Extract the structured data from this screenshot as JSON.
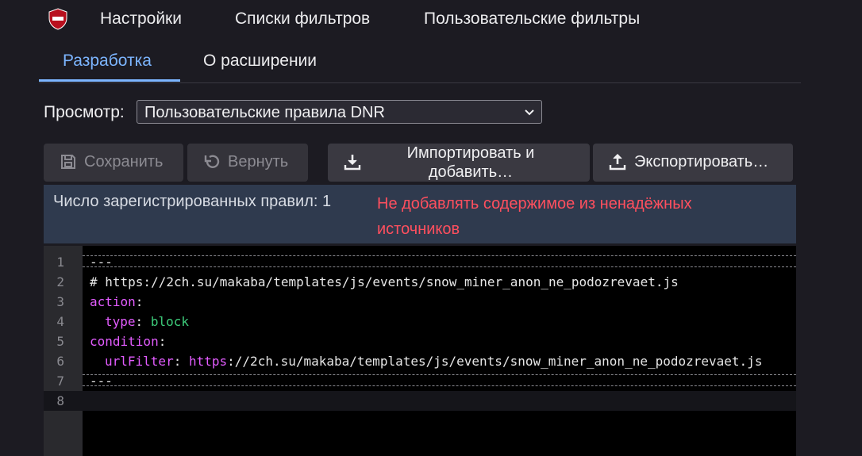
{
  "topnav": {
    "tabs": [
      "Настройки",
      "Списки фильтров",
      "Пользовательские фильтры"
    ]
  },
  "subtabs": [
    "Разработка",
    "О расширении"
  ],
  "view": {
    "label": "Просмотр:",
    "selected": "Пользовательские правила DNR"
  },
  "toolbar": {
    "save": "Сохранить",
    "revert": "Вернуть",
    "import_line1": "Импортировать и",
    "import_line2": "добавить…",
    "export": "Экспортировать…"
  },
  "info": {
    "count": "Число зарегистрированных правил: 1",
    "warning": "Не добавлять содержимое из ненадёжных источников"
  },
  "editor": {
    "line_numbers": [
      "1",
      "2",
      "3",
      "4",
      "5",
      "6",
      "7",
      "8"
    ],
    "sep": "---",
    "comment": "# https://2ch.su/makaba/templates/js/events/snow_miner_anon_ne_podozrevaet.js",
    "action_key": "action",
    "type_key": "type",
    "type_value": "block",
    "condition_key": "condition",
    "urlfilter_key": "urlFilter",
    "urlfilter_scheme": "https",
    "urlfilter_rest": "://2ch.su/makaba/templates/js/events/snow_miner_anon_ne_podozrevaet.js",
    "colon": ":"
  },
  "colors": {
    "accent": "#7cb5ff",
    "warning": "#ff4f5e",
    "comment": "#ff6f3c",
    "key": "#e35cff",
    "value": "#3dcb7a"
  }
}
